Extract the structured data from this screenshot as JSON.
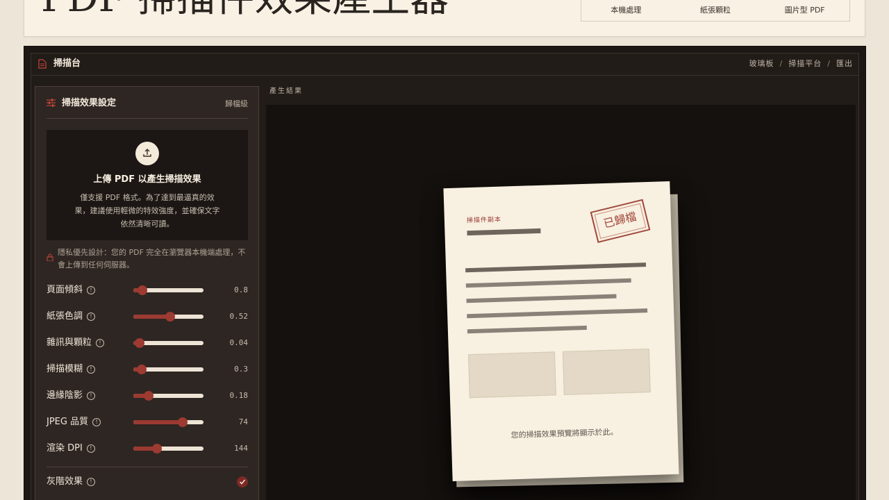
{
  "header": {
    "title": "PDF 掃描件效果產生器",
    "features": [
      "本機處理",
      "紙張顆粒",
      "圖片型 PDF"
    ]
  },
  "workspace": {
    "title": "掃描台",
    "breadcrumb": [
      "玻璃板",
      "掃描平台",
      "匯出"
    ],
    "breadcrumb_sep": "/"
  },
  "settings": {
    "title": "掃描效果設定",
    "tag": "歸檔級",
    "upload": {
      "title": "上傳 PDF 以產生掃描效果",
      "desc": "僅支援 PDF 格式。為了達到最逼真的效果，建議使用輕微的特效強度，並確保文字依然清晰可讀。"
    },
    "privacy": "隱私優先設計：您的 PDF 完全在瀏覽器本機端處理，不會上傳到任何伺服器。",
    "sliders": [
      {
        "label": "頁面傾斜",
        "value": "0.8",
        "fraction": 0.13
      },
      {
        "label": "紙張色調",
        "value": "0.52",
        "fraction": 0.52
      },
      {
        "label": "雜訊與顆粒",
        "value": "0.04",
        "fraction": 0.09
      },
      {
        "label": "掃描模糊",
        "value": "0.3",
        "fraction": 0.12
      },
      {
        "label": "邊緣陰影",
        "value": "0.18",
        "fraction": 0.22
      },
      {
        "label": "JPEG 品質",
        "value": "74",
        "fraction": 0.7
      },
      {
        "label": "渲染 DPI",
        "value": "144",
        "fraction": 0.34
      }
    ],
    "grayscale": {
      "label": "灰階效果",
      "checked": true
    }
  },
  "result": {
    "label": "產生結果",
    "paper_tag": "掃描件副本",
    "stamp": "已歸檔",
    "message": "您的掃描效果預覽將顯示於此。"
  },
  "colors": {
    "accent": "#9a3a32",
    "background": "#ece5d8",
    "frame": "#1c1714"
  }
}
